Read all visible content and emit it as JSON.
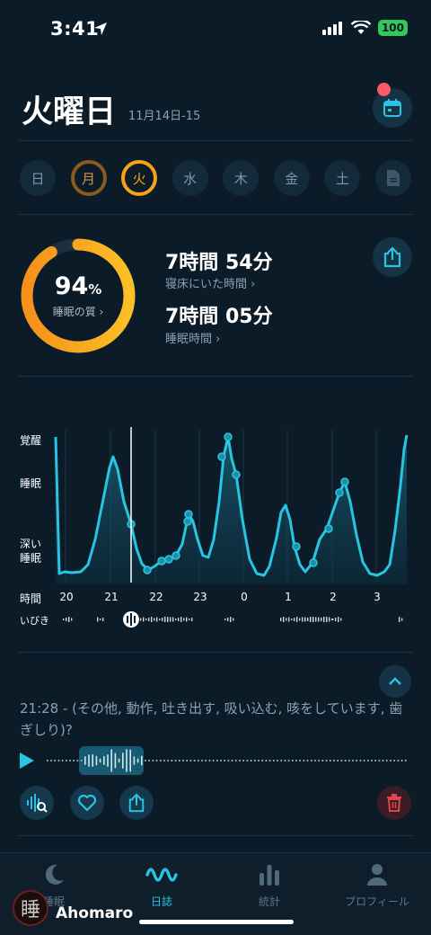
{
  "status": {
    "time": "3:41",
    "battery": "100"
  },
  "header": {
    "day": "火曜日",
    "date_range": "11月14日-15"
  },
  "week": [
    "日",
    "月",
    "火",
    "水",
    "木",
    "金",
    "土"
  ],
  "summary": {
    "quality_percent": "94",
    "quality_unit": "%",
    "quality_value": 94,
    "quality_label": "睡眠の質 ›",
    "time_in_bed": "7時間 54分",
    "time_in_bed_label": "寝床にいた時間 ›",
    "sleep_time": "7時間 05分",
    "sleep_time_label": "睡眠時間 ›"
  },
  "chart_data": {
    "type": "area",
    "y_levels": [
      "覚醒",
      "睡眠",
      "深い\n睡眠"
    ],
    "x_ticks": [
      "20",
      "21",
      "22",
      "23",
      "0",
      "1",
      "2",
      "3"
    ],
    "x_axis_label": "時間",
    "snore_label": "いびき"
  },
  "detail": {
    "text": "21:28 - (その他, 動作, 吐き出す, 吸い込む, 咳をしています, 歯ぎしり)?"
  },
  "tabs": [
    {
      "label": "睡眠"
    },
    {
      "label": "日誌"
    },
    {
      "label": "統計"
    },
    {
      "label": "プロフィール"
    }
  ],
  "watermark": {
    "text": "Ahomaro",
    "seal": "睡"
  },
  "colors": {
    "accent": "#28c4e0",
    "orange": "#f6a21b",
    "delete": "#e0454a",
    "background": "#0b1b27"
  }
}
